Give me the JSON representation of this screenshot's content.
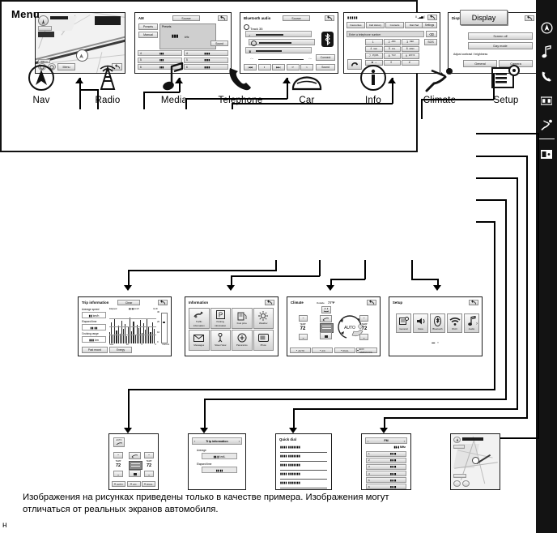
{
  "caption": {
    "line1": "Изображения на рисунках приведены только в качестве примера. Изображения могут",
    "line2": "отличаться от реальных экранов автомобиля.",
    "stray": "н"
  },
  "menu": {
    "title": "Menu",
    "display_button": "Display",
    "items": [
      {
        "label": "Nav",
        "icon": "nav-compass-icon"
      },
      {
        "label": "Radio",
        "icon": "radio-tower-icon"
      },
      {
        "label": "Media",
        "icon": "music-note-icon"
      },
      {
        "label": "Telephone",
        "icon": "phone-handset-icon"
      },
      {
        "label": "Car",
        "icon": "car-icon"
      },
      {
        "label": "Info",
        "icon": "info-circle-icon"
      },
      {
        "label": "Climate",
        "icon": "climate-seat-icon"
      },
      {
        "label": "Setup",
        "icon": "setup-gear-icon"
      }
    ],
    "sidebar": [
      {
        "icon": "nav-compass-icon"
      },
      {
        "icon": "music-note-icon"
      },
      {
        "icon": "phone-handset-icon"
      },
      {
        "icon": "car-icon"
      },
      {
        "icon": "climate-seat-icon"
      },
      {
        "icon": "display-screen-icon"
      }
    ]
  },
  "top_screens": {
    "nav": {
      "title": "",
      "scale_label": "500 m",
      "menu_button": "Menu",
      "back_icon": "back-arrow-icon"
    },
    "radio": {
      "title": "AM",
      "source_button": "Source",
      "presets_tab": "Presets",
      "manual_tab": "Manual",
      "panel_label": "Presets",
      "freq_value": "▮▮▮",
      "freq_unit": "kHz",
      "sound_button": "Sound",
      "back_icon": "back-arrow-icon",
      "preset_rows": [
        {
          "left_no": "4",
          "left_val": "▮▮▮",
          "right_no": "4",
          "right_val": "▮▮▮▮"
        },
        {
          "left_no": "5",
          "left_val": "▮▮▮",
          "right_no": "5",
          "right_val": "▮▮▮▮"
        },
        {
          "left_no": "6",
          "left_val": "▮▮▮",
          "right_no": "6",
          "right_val": "▮▮▮▮"
        }
      ]
    },
    "bluetooth": {
      "title": "Bluetooth audio",
      "source_button": "Source",
      "track_label": "Track",
      "track_no": "35",
      "connect_button": "Connect",
      "sound_button": "Sound",
      "time_left": "-:--",
      "time_right": "-:--",
      "bt_icon": "bluetooth-icon",
      "back_icon": "back-arrow-icon",
      "rows": [
        "song-row",
        "artist-row",
        "album-row"
      ],
      "transport": [
        "prev-icon",
        "pause-icon",
        "next-icon",
        "repeat-icon",
        "shuffle-icon"
      ]
    },
    "phone": {
      "signal": "▮▮▮▮▮",
      "status_right": "0",
      "tabs": [
        "Favourites",
        "Call History",
        "Contacts",
        "Dial Pad"
      ],
      "settings_button": "Settings",
      "input_placeholder": "Enter a telephone number",
      "sos_button": "SOS",
      "call_icon": "call-icon",
      "back_icon": "back-arrow-icon",
      "keys": [
        [
          "1",
          ""
        ],
        [
          "2",
          "ABC"
        ],
        [
          "3",
          "DEF"
        ],
        [
          "4",
          "GHI"
        ],
        [
          "5",
          "JKL"
        ],
        [
          "6",
          "MNO"
        ],
        [
          "7",
          "PQRS"
        ],
        [
          "8",
          "TUV"
        ],
        [
          "9",
          "WXYZ"
        ],
        [
          "✱",
          "+"
        ],
        [
          "0",
          ""
        ],
        [
          "#",
          ""
        ]
      ]
    },
    "display": {
      "title": "Display",
      "screen_off_button": "Screen off",
      "day_mode_button": "Day mode",
      "adjust_label": "Adjust contrast / brightness",
      "general_button": "General",
      "camera_button": "Camera",
      "back_icon": "back-arrow-icon"
    }
  },
  "mid_screens": {
    "trip": {
      "title": "Trip information",
      "clear_button": "Clear",
      "back_icon": "back-arrow-icon",
      "avg_label": "Average speed",
      "avg_value": "▮▮ km/h",
      "elapsed_label": "Elapsed time",
      "elapsed_value": "▮▮:▮▮",
      "range_label": "Cruising range",
      "range_value": "▮▮▮ km",
      "past_record_button": "Past record",
      "energy_button": "Energy",
      "chart_axis_left": "Elapsed",
      "chart_axis_mid": "▮▮:▮▮ km/h",
      "chart_axis_unit": "km/h",
      "chart_ticks": [
        "30",
        "20",
        "10",
        "0"
      ],
      "chart_x": [
        "Now",
        "10",
        "5",
        "0"
      ],
      "chart_right_label": "Current"
    },
    "information": {
      "title": "Information",
      "back_icon": "back-arrow-icon",
      "tiles": [
        {
          "label1": "Traffic",
          "label2": "information",
          "icon": "traffic-icon"
        },
        {
          "label1": "Parking",
          "label2": "information",
          "icon": "parking-icon"
        },
        {
          "label1": "Fuel price",
          "label2": "",
          "icon": "fuel-price-icon"
        },
        {
          "label1": "Weather",
          "label2": "",
          "icon": "weather-icon"
        },
        {
          "label1": "Messages",
          "label2": "",
          "icon": "envelope-icon"
        },
        {
          "label1": "Street View",
          "label2": "",
          "icon": "street-view-icon"
        },
        {
          "label1": "Panoramio",
          "label2": "",
          "icon": "panoramio-icon"
        },
        {
          "label1": "Photo",
          "label2": "",
          "icon": "photo-icon"
        }
      ]
    },
    "climate": {
      "title": "Climate",
      "outside_label": "Outside",
      "outside_value": "77°F",
      "back_icon": "back-arrow-icon",
      "temp_label": "TEMP",
      "temp_left": "72",
      "temp_right": "72",
      "auto_label": "AUTO",
      "bottom_buttons": [
        "AUTO",
        "A/C",
        "DUAL",
        "ECO HARD/COOL"
      ]
    },
    "setup": {
      "title": "Setup",
      "back_icon": "back-arrow-icon",
      "tiles": [
        {
          "label": "General",
          "icon": "general-icon"
        },
        {
          "label": "Voice",
          "icon": "voice-icon"
        },
        {
          "label": "Bluetooth",
          "icon": "bluetooth-icon"
        },
        {
          "label": "Wi-Fi",
          "icon": "wifi-icon"
        },
        {
          "label": "Audio",
          "icon": "audio-icon"
        }
      ],
      "next_arrow": "›",
      "page_dots": "▬ ▪"
    }
  },
  "bottom_screens": {
    "climate_small": {
      "auto_label": "AUTO",
      "temp_label": "TEMP",
      "temp_left": "72",
      "temp_right": "72",
      "buttons": [
        "AUTO",
        "A/C",
        "DUAL"
      ]
    },
    "trip_small": {
      "title": "Trip information",
      "prev_icon": "chevron-left-icon",
      "next_icon": "chevron-right-icon",
      "avg_label": "Average",
      "avg_value": "▮▮.▮ km/L",
      "elapsed_label": "Elapsed time",
      "elapsed_value": "▮▮:▮▮"
    },
    "quick_dial": {
      "title": "Quick dial",
      "rows": [
        "▮▮▮▮ ▮▮▮▮▮▮▮",
        "▮▮▮▮ ▮▮▮▮▮▮▮",
        "▮▮▮▮ ▮▮▮▮▮▮▮",
        "▮▮▮▮ ▮▮▮▮▮▮▮",
        "▮▮▮▮ ▮▮▮▮▮▮▮"
      ]
    },
    "radio_small": {
      "title": "FM",
      "prev_icon": "chevron-left-icon",
      "next_icon": "chevron-right-icon",
      "freq": "▮▮.▮ MHz",
      "rows": [
        {
          "no": "1",
          "val": "▮▮.▮▮"
        },
        {
          "no": "2",
          "val": "▮▮.▮▮"
        },
        {
          "no": "3",
          "val": "▮▮.▮▮"
        },
        {
          "no": "4",
          "val": "▮▮.▮▮"
        },
        {
          "no": "5",
          "val": "▮▮.▮▮"
        },
        {
          "no": "6",
          "val": "▮▮.▮▮"
        }
      ]
    },
    "nav_small": {
      "menu_button": "",
      "icon": "map-icon"
    }
  }
}
